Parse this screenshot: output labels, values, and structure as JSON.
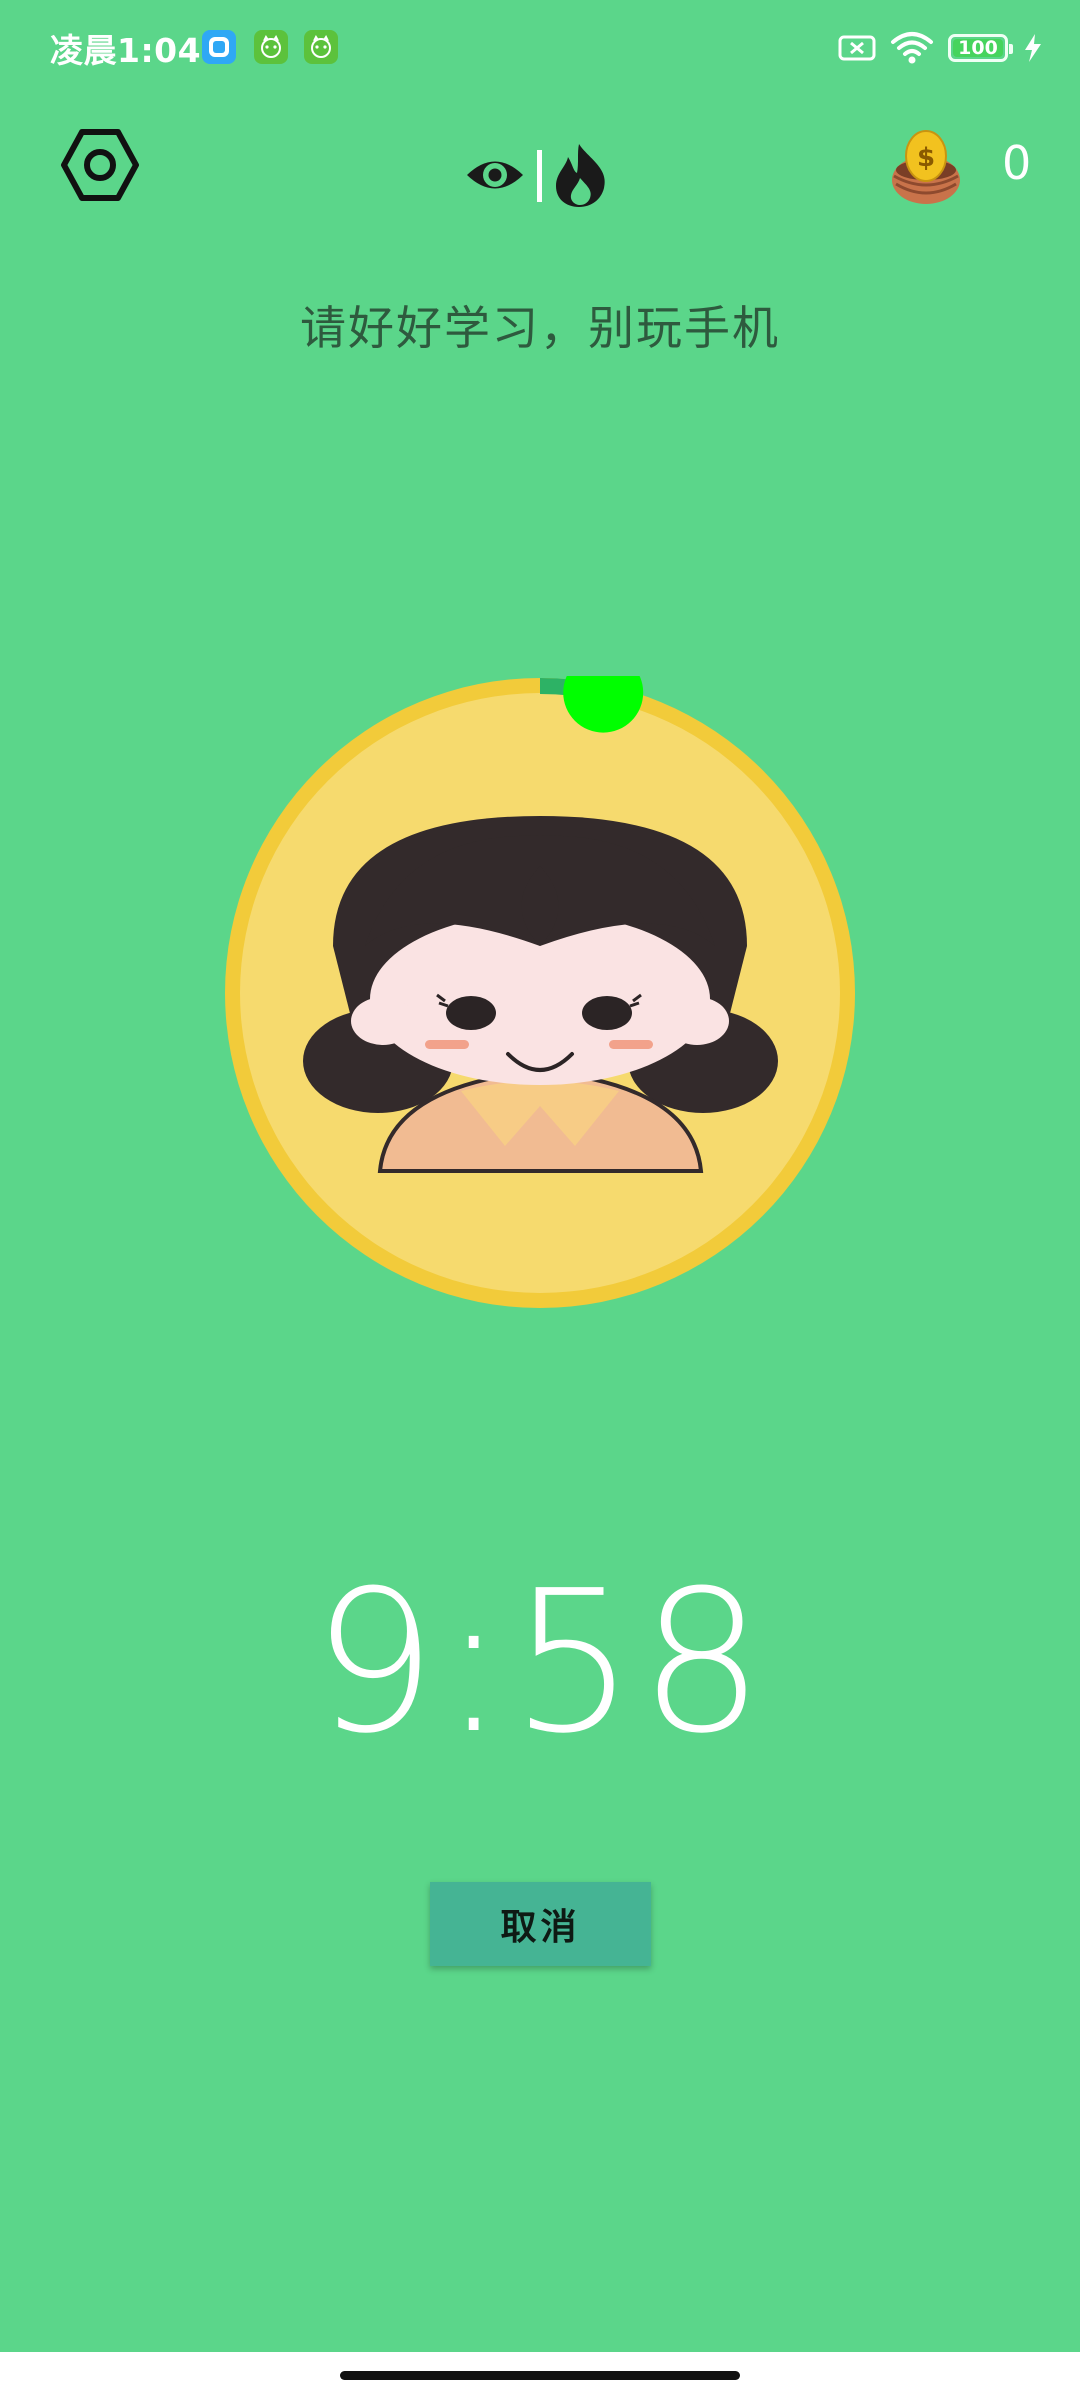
{
  "status_bar": {
    "time": "凌晨1:04",
    "battery": "100",
    "icons": [
      "app-icon-blue",
      "app-icon-green-cat",
      "app-icon-green-cat",
      "sim-error-icon",
      "wifi-icon",
      "battery-icon",
      "charging-bolt-icon"
    ]
  },
  "top_bar": {
    "settings_icon": "hexagon-settings-icon",
    "mode_icons": [
      "eye-icon",
      "fire-icon"
    ],
    "coin_icon": "coin-nest-icon",
    "coin_count": "0"
  },
  "motto": "请好好学习，别玩手机",
  "focus": {
    "avatar": "girl-avatar-icon",
    "progress_fraction": 0.033,
    "timer": "9:58"
  },
  "actions": {
    "cancel_label": "取消"
  },
  "colors": {
    "background": "#5BD68A",
    "progress_ring": "#2DB265",
    "progress_knob": "#00FF00",
    "avatar_ring": "#F2CB3A",
    "avatar_fill": "#F6DA6E",
    "cancel_button": "#45B494"
  }
}
